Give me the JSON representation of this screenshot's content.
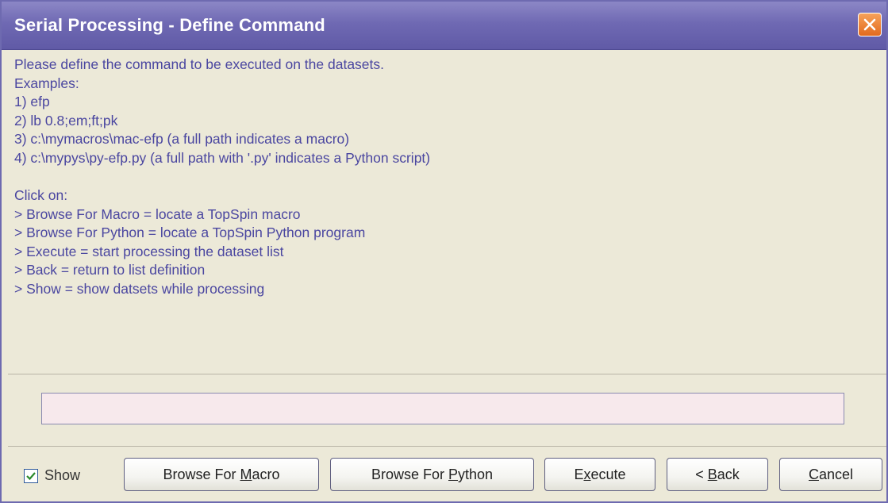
{
  "window": {
    "title": "Serial Processing - Define Command"
  },
  "message": {
    "lines": [
      "Please define the command to be executed on the datasets.",
      "Examples:",
      "1) efp",
      "2) lb 0.8;em;ft;pk",
      "3) c:\\mymacros\\mac-efp (a full path indicates a macro)",
      "4) c:\\mypys\\py-efp.py (a full path with '.py' indicates a Python script)",
      "",
      "Click on:",
      "> Browse For Macro = locate a TopSpin macro",
      "> Browse For Python = locate a TopSpin Python program",
      "> Execute = start processing the dataset list",
      "> Back = return to list definition",
      "> Show = show datsets while processing"
    ]
  },
  "command_field": {
    "value": "",
    "placeholder": ""
  },
  "footer": {
    "show_label": "Show",
    "show_checked": true,
    "buttons": {
      "browse_macro": {
        "pre": "Browse For ",
        "mnemonic": "M",
        "post": "acro"
      },
      "browse_python": {
        "pre": "Browse For ",
        "mnemonic": "P",
        "post": "ython"
      },
      "execute": {
        "pre": "E",
        "mnemonic": "x",
        "post": "ecute"
      },
      "back": {
        "pre": "< ",
        "mnemonic": "B",
        "post": "ack"
      },
      "cancel": {
        "pre": "",
        "mnemonic": "C",
        "post": "ancel"
      }
    }
  },
  "colors": {
    "title_bar": "#6f69b3",
    "message_text": "#4a46a0",
    "close_button": "#e26a1e",
    "input_background": "#f7e9ec"
  },
  "icons": {
    "close": "close-x-icon",
    "checkbox": "checkmark-icon"
  }
}
